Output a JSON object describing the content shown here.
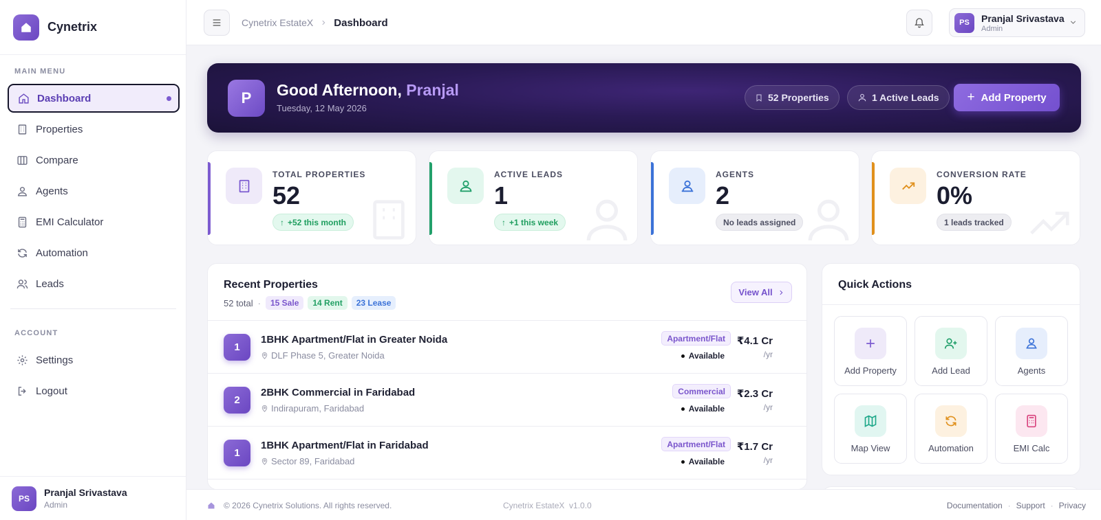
{
  "brand": {
    "name": "Cynetrix"
  },
  "sidebar": {
    "main_heading": "MAIN MENU",
    "items": [
      {
        "label": "Dashboard",
        "icon": "home-icon"
      },
      {
        "label": "Properties",
        "icon": "building-icon"
      },
      {
        "label": "Compare",
        "icon": "columns-icon"
      },
      {
        "label": "Agents",
        "icon": "agent-icon"
      },
      {
        "label": "EMI Calculator",
        "icon": "calculator-icon"
      },
      {
        "label": "Automation",
        "icon": "refresh-icon"
      },
      {
        "label": "Leads",
        "icon": "users-icon"
      }
    ],
    "account_heading": "ACCOUNT",
    "account_items": [
      {
        "label": "Settings",
        "icon": "gear-icon"
      },
      {
        "label": "Logout",
        "icon": "logout-icon"
      }
    ],
    "user": {
      "initials": "PS",
      "name": "Pranjal Srivastava",
      "role": "Admin"
    }
  },
  "header": {
    "breadcrumb": [
      "Cynetrix EstateX",
      "Dashboard"
    ],
    "user": {
      "initials": "PS",
      "name": "Pranjal Srivastava",
      "role": "Admin"
    }
  },
  "hero": {
    "initial": "P",
    "greeting": "Good Afternoon, ",
    "name": "Pranjal",
    "date": "Tuesday, 12 May 2026",
    "properties_pill": "52 Properties",
    "leads_pill": "1 Active Leads",
    "add_button": "Add Property"
  },
  "stats": [
    {
      "label": "TOTAL PROPERTIES",
      "value": "52",
      "badge": "+52 this month",
      "accent": "#7c5bd0"
    },
    {
      "label": "ACTIVE LEADS",
      "value": "1",
      "badge": "+1 this week",
      "accent": "#22a06b"
    },
    {
      "label": "AGENTS",
      "value": "2",
      "badge": "No leads assigned",
      "accent": "#3b72d8"
    },
    {
      "label": "CONVERSION RATE",
      "value": "0%",
      "badge": "1 leads tracked",
      "accent": "#e0901c"
    }
  ],
  "recent": {
    "title": "Recent Properties",
    "total": "52 total",
    "dot": "·",
    "sale": "15 Sale",
    "rent": "14 Rent",
    "lease": "23 Lease",
    "view_all": "View All",
    "rows": [
      {
        "num": "1",
        "title": "1BHK Apartment/Flat in Greater Noida",
        "location": "DLF Phase 5, Greater Noida",
        "type": "Apartment/Flat",
        "status": "Available",
        "price": "₹4.1 Cr",
        "per": "/yr"
      },
      {
        "num": "2",
        "title": "2BHK Commercial in Faridabad",
        "location": "Indirapuram, Faridabad",
        "type": "Commercial",
        "status": "Available",
        "price": "₹2.3 Cr",
        "per": "/yr"
      },
      {
        "num": "1",
        "title": "1BHK Apartment/Flat in Faridabad",
        "location": "Sector 89, Faridabad",
        "type": "Apartment/Flat",
        "status": "Available",
        "price": "₹1.7 Cr",
        "per": "/yr"
      }
    ]
  },
  "quick": {
    "title": "Quick Actions",
    "actions": [
      {
        "label": "Add Property",
        "icon": "plus-icon"
      },
      {
        "label": "Add Lead",
        "icon": "user-plus-icon"
      },
      {
        "label": "Agents",
        "icon": "agent-icon"
      },
      {
        "label": "Map View",
        "icon": "map-icon"
      },
      {
        "label": "Automation",
        "icon": "refresh-icon"
      },
      {
        "label": "EMI Calc",
        "icon": "calculator-icon"
      }
    ]
  },
  "footer": {
    "copyright": "© 2026 Cynetrix Solutions. All rights reserved.",
    "version": "Cynetrix EstateX  v1.0.0",
    "links": [
      "Documentation",
      "Support",
      "Privacy"
    ],
    "sep": "·"
  }
}
